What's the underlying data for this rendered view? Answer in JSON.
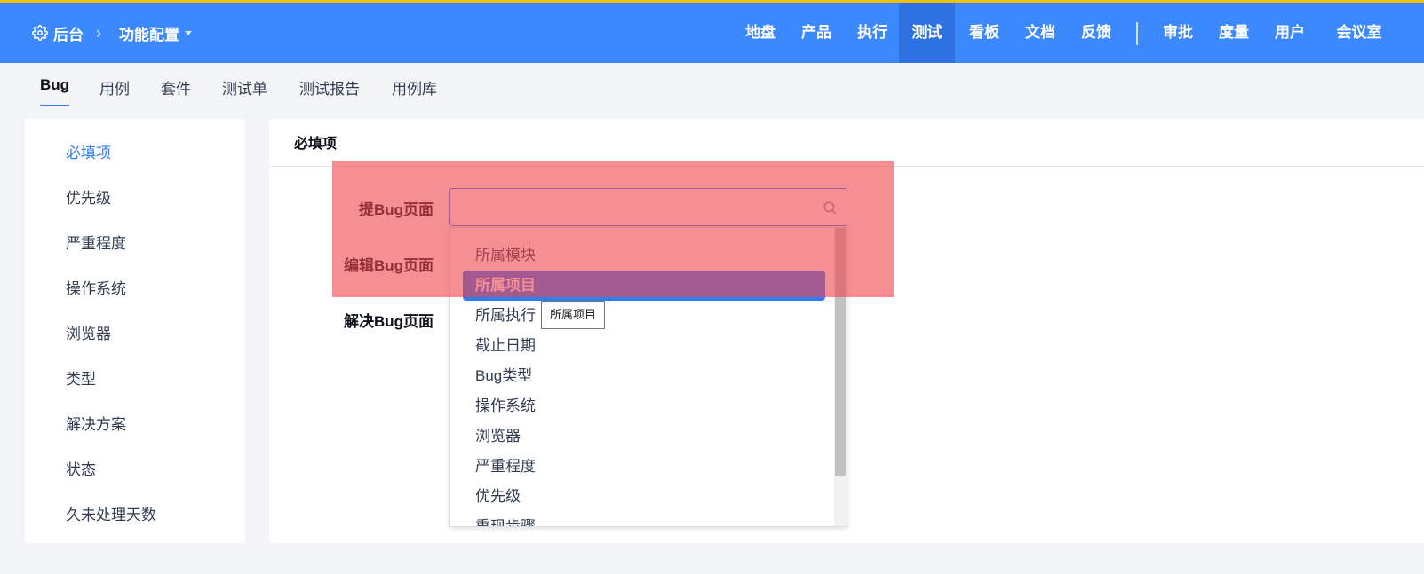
{
  "header": {
    "breadcrumb": {
      "home": "后台",
      "separator": "›",
      "current": "功能配置"
    },
    "nav": [
      "地盘",
      "产品",
      "执行",
      "测试",
      "看板",
      "文档",
      "反馈",
      "审批",
      "度量",
      "用户",
      "会议室"
    ],
    "active_nav": "测试",
    "colors": {
      "bar": "#3b88ff",
      "active": "#2e71e0",
      "top_border": "#f2c00a"
    }
  },
  "subtabs": [
    "Bug",
    "用例",
    "套件",
    "测试单",
    "测试报告",
    "用例库"
  ],
  "sidebar": {
    "items": [
      "必填项",
      "优先级",
      "严重程度",
      "操作系统",
      "浏览器",
      "类型",
      "解决方案",
      "状态",
      "久未处理天数"
    ],
    "active": "必填项"
  },
  "main": {
    "title": "必填项",
    "labels": [
      "提Bug页面",
      "编辑Bug页面",
      "解决Bug页面"
    ],
    "search": {
      "value": "",
      "placeholder": ""
    },
    "dropdown_options": [
      "所属模块",
      "所属项目",
      "所属执行",
      "截止日期",
      "Bug类型",
      "操作系统",
      "浏览器",
      "严重程度",
      "优先级",
      "重现步骤"
    ],
    "selected_option": "所属项目",
    "tooltip": "所属项目"
  },
  "icons": {
    "home": "gear-icon",
    "search": "search-icon",
    "dropdown": "chevron-down-icon"
  }
}
